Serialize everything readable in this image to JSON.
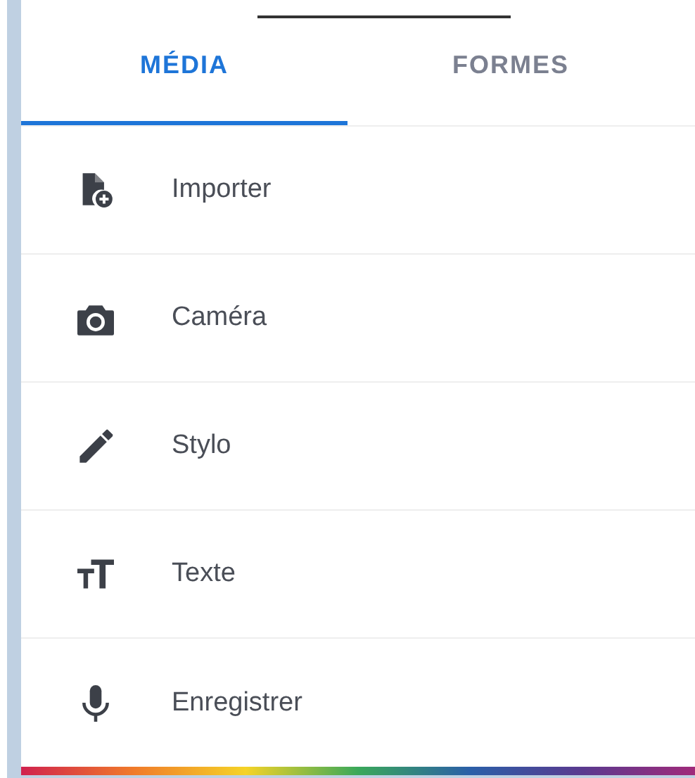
{
  "tabs": [
    {
      "label": "MÉDIA",
      "selected": true
    },
    {
      "label": "FORMES",
      "selected": false
    }
  ],
  "items": [
    {
      "label": "Importer"
    },
    {
      "label": "Caméra"
    },
    {
      "label": "Stylo"
    },
    {
      "label": "Texte"
    },
    {
      "label": "Enregistrer"
    }
  ]
}
